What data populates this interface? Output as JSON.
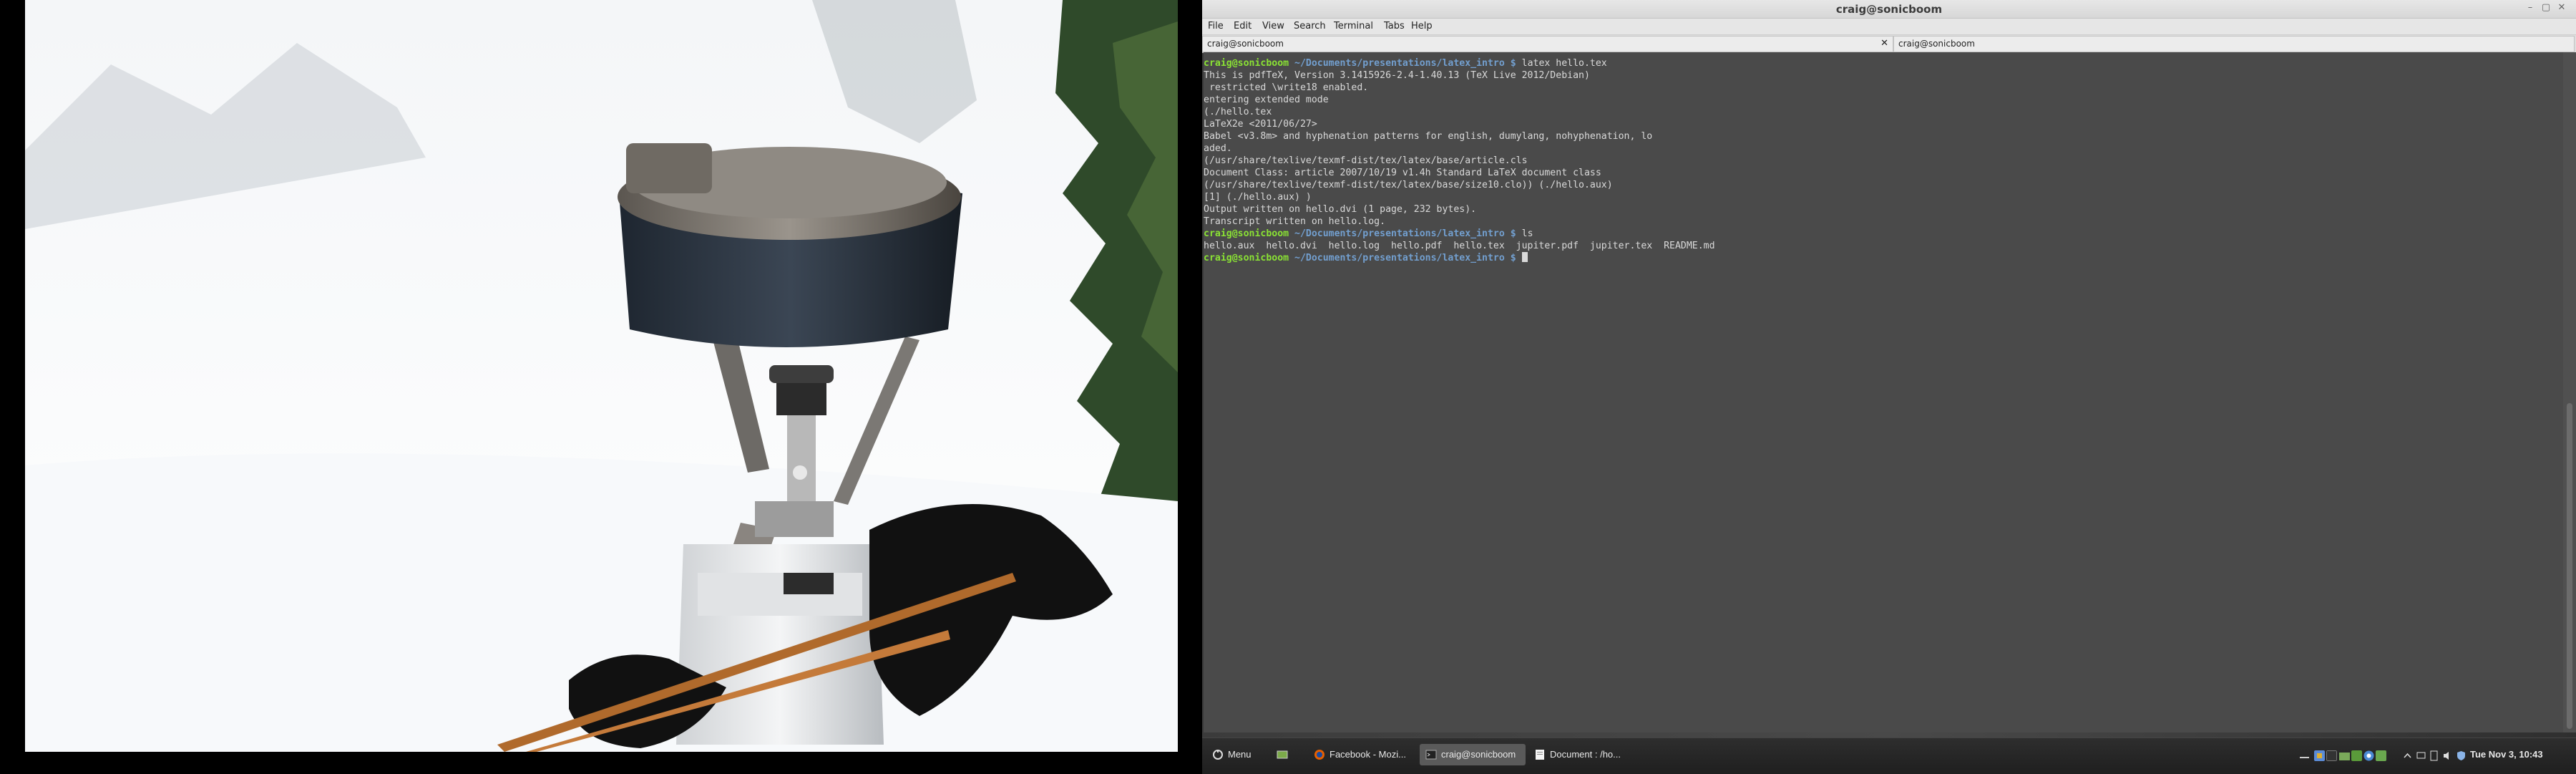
{
  "window": {
    "title": "craig@sonicboom",
    "minimize_glyph": "–",
    "maximize_glyph": "▢",
    "close_glyph": "✕"
  },
  "menubar": {
    "items": [
      "File",
      "Edit",
      "View",
      "Search",
      "Terminal",
      "Tabs",
      "Help"
    ]
  },
  "tabs": [
    {
      "label": "craig@sonicboom",
      "close": "✕"
    },
    {
      "label": "craig@sonicboom"
    }
  ],
  "terminal": {
    "prompt_user": "craig@sonicboom",
    "prompt_path": " ~/Documents/presentations/latex_intro $",
    "cmd1": " latex hello.tex",
    "output": [
      "This is pdfTeX, Version 3.1415926-2.4-1.40.13 (TeX Live 2012/Debian)",
      " restricted \\write18 enabled.",
      "entering extended mode",
      "(./hello.tex",
      "LaTeX2e <2011/06/27>",
      "Babel <v3.8m> and hyphenation patterns for english, dumylang, nohyphenation, lo",
      "aded.",
      "(/usr/share/texlive/texmf-dist/tex/latex/base/article.cls",
      "Document Class: article 2007/10/19 v1.4h Standard LaTeX document class",
      "(/usr/share/texlive/texmf-dist/tex/latex/base/size10.clo)) (./hello.aux)",
      "[1] (./hello.aux) )",
      "Output written on hello.dvi (1 page, 232 bytes).",
      "Transcript written on hello.log."
    ],
    "cmd2": " ls",
    "ls_output": "hello.aux  hello.dvi  hello.log  hello.pdf  hello.tex  jupiter.pdf  jupiter.tex  README.md",
    "cmd3": " "
  },
  "taskbar": {
    "menu_label": "Menu",
    "windows": [
      {
        "label": "Facebook - Mozi...",
        "icon": "firefox-icon"
      },
      {
        "label": "craig@sonicboom",
        "icon": "terminal-icon",
        "active": true
      },
      {
        "label": "Document : /ho...",
        "icon": "document-icon"
      }
    ],
    "clock": "Tue Nov  3, 10:43"
  },
  "colors": {
    "terminal_bg": "#4a4a4a",
    "prompt_user": "#8ae234",
    "prompt_path": "#729fcf"
  }
}
